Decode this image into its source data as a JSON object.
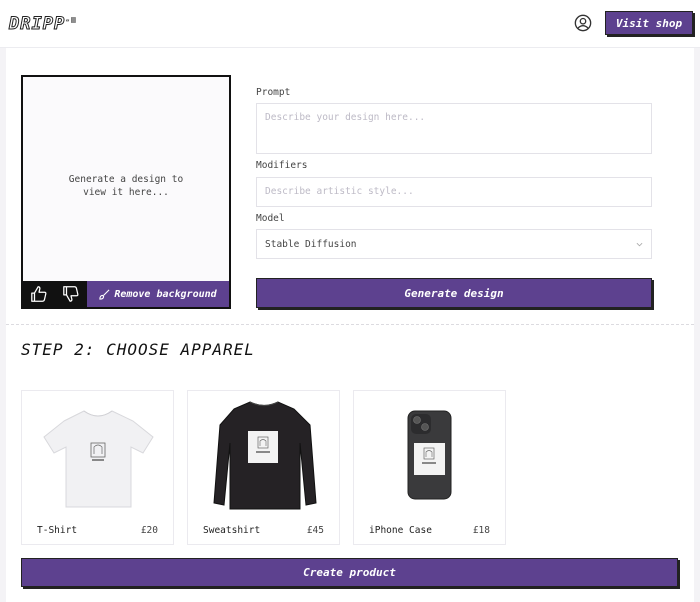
{
  "header": {
    "logo": "DRIPP",
    "logo_mark": "-≡",
    "visit_shop_label": "Visit shop"
  },
  "preview": {
    "placeholder_line1": "Generate a design to",
    "placeholder_line2": "view it here...",
    "remove_background_label": "Remove background"
  },
  "form": {
    "prompt_label": "Prompt",
    "prompt_placeholder": "Describe your design here...",
    "modifiers_label": "Modifiers",
    "modifiers_placeholder": "Describe artistic style...",
    "model_label": "Model",
    "model_value": "Stable Diffusion",
    "generate_label": "Generate design"
  },
  "step2": {
    "title": "STEP 2: CHOOSE APPAREL",
    "products": [
      {
        "name": "T-Shirt",
        "price": "£20"
      },
      {
        "name": "Sweatshirt",
        "price": "£45"
      },
      {
        "name": "iPhone Case",
        "price": "£18"
      }
    ],
    "create_label": "Create product"
  },
  "colors": {
    "accent": "#5d418f",
    "border": "#222222"
  }
}
